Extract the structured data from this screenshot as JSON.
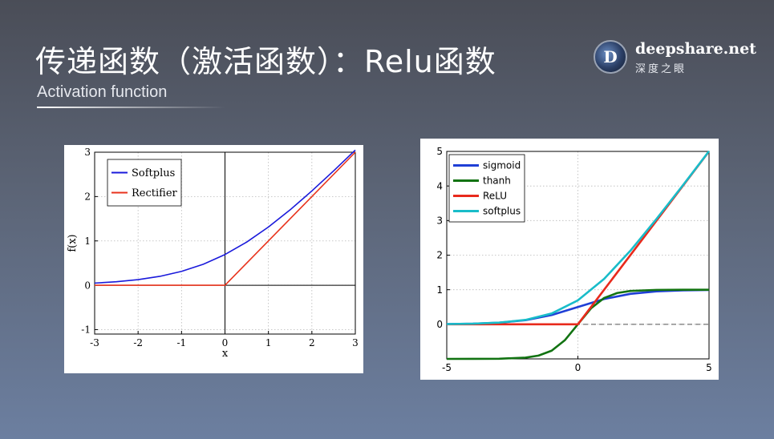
{
  "slide": {
    "title": "传递函数（激活函数）：Relu函数",
    "subtitle": "Activation function"
  },
  "logo": {
    "icon_letter": "D",
    "name": "deepshare.net",
    "tagline": "深度之眼"
  },
  "chart_data": [
    {
      "type": "line",
      "title": "",
      "xlabel": "x",
      "ylabel": "f(x)",
      "xlim": [
        -3,
        3
      ],
      "ylim": [
        -1.1,
        3
      ],
      "xticks": [
        -3,
        -2,
        -1,
        0,
        1,
        2,
        3
      ],
      "yticks": [
        -1,
        0,
        1,
        2,
        3
      ],
      "grid": true,
      "legend": "top-left",
      "series": [
        {
          "name": "Softplus",
          "color": "#1a1adb",
          "x": [
            -3,
            -2.5,
            -2,
            -1.5,
            -1,
            -0.5,
            0,
            0.5,
            1,
            1.5,
            2,
            2.5,
            3
          ],
          "y": [
            0.049,
            0.079,
            0.127,
            0.201,
            0.313,
            0.474,
            0.693,
            0.974,
            1.313,
            1.701,
            2.127,
            2.579,
            3.049
          ]
        },
        {
          "name": "Rectifier",
          "color": "#e8331c",
          "x": [
            -3,
            0,
            3
          ],
          "y": [
            0,
            0,
            3
          ]
        }
      ]
    },
    {
      "type": "line",
      "title": "",
      "xlabel": "",
      "ylabel": "",
      "xlim": [
        -5,
        5
      ],
      "ylim": [
        -1,
        5
      ],
      "xticks": [
        -5,
        0,
        5
      ],
      "yticks": [
        0,
        1,
        2,
        3,
        4,
        5
      ],
      "grid": true,
      "legend": "top-left",
      "series": [
        {
          "name": "sigmoid",
          "color": "#1f3fd6",
          "x": [
            -5,
            -4,
            -3,
            -2,
            -1,
            0,
            1,
            2,
            3,
            4,
            5
          ],
          "y": [
            0.007,
            0.018,
            0.047,
            0.119,
            0.269,
            0.5,
            0.731,
            0.881,
            0.953,
            0.982,
            0.993
          ]
        },
        {
          "name": "thanh",
          "color": "#127312",
          "x": [
            -5,
            -4,
            -3,
            -2,
            -1.5,
            -1,
            -0.5,
            0,
            0.5,
            1,
            1.5,
            2,
            3,
            4,
            5
          ],
          "y": [
            -1,
            -0.999,
            -0.995,
            -0.964,
            -0.905,
            -0.762,
            -0.462,
            0,
            0.462,
            0.762,
            0.905,
            0.964,
            0.995,
            0.999,
            1
          ]
        },
        {
          "name": "ReLU",
          "color": "#e82a1c",
          "x": [
            -5,
            0,
            5
          ],
          "y": [
            0,
            0,
            5
          ]
        },
        {
          "name": "softplus",
          "color": "#19bcc9",
          "x": [
            -5,
            -4,
            -3,
            -2,
            -1,
            0,
            1,
            2,
            3,
            4,
            5
          ],
          "y": [
            0.007,
            0.018,
            0.049,
            0.127,
            0.313,
            0.693,
            1.313,
            2.127,
            3.049,
            4.018,
            5.007
          ]
        }
      ]
    }
  ]
}
